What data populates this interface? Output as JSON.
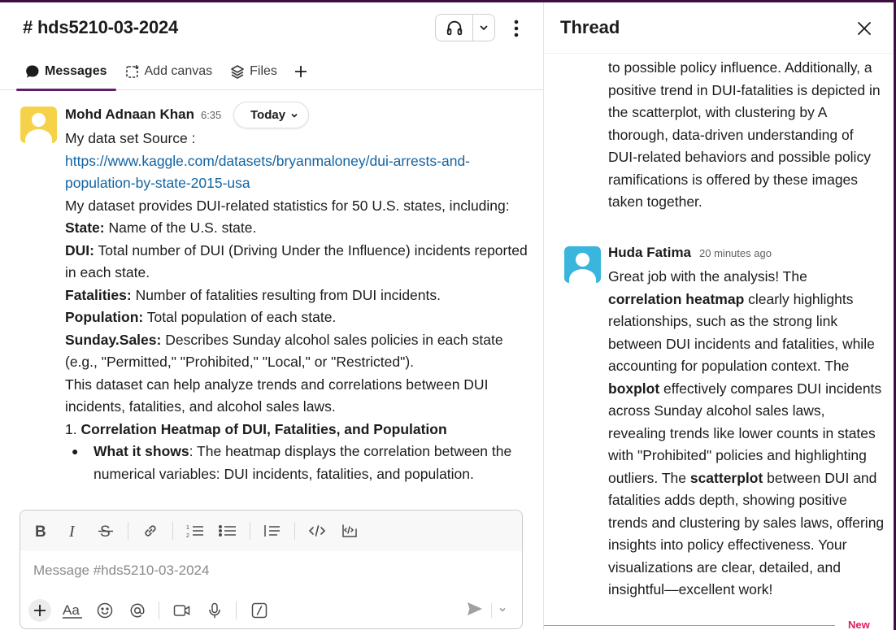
{
  "channel": {
    "name": "# hds5210-03-2024",
    "tabs": [
      {
        "label": "Messages"
      },
      {
        "label": "Add canvas"
      },
      {
        "label": "Files"
      }
    ]
  },
  "message": {
    "author": "Mohd Adnaan Khan",
    "time": "6:35",
    "date_pill": "Today",
    "line1": "My data set Source :",
    "link": "https://www.kaggle.com/datasets/bryanmaloney/dui-arrests-and-population-by-state-2015-usa",
    "intro": "My dataset provides DUI-related statistics for 50 U.S. states, including:",
    "fields": [
      {
        "name": "State:",
        "desc": " Name of the U.S. state."
      },
      {
        "name": "DUI:",
        "desc": " Total number of DUI (Driving Under the Influence) incidents reported in each state."
      },
      {
        "name": "Fatalities:",
        "desc": " Number of fatalities resulting from DUI incidents."
      },
      {
        "name": "Population:",
        "desc": " Total population of each state."
      },
      {
        "name": "Sunday.Sales:",
        "desc": " Describes Sunday alcohol sales policies in each state (e.g., \"Permitted,\" \"Prohibited,\" \"Local,\" or \"Restricted\")."
      }
    ],
    "summary": "This dataset can help analyze trends and correlations between DUI incidents, fatalities, and alcohol sales laws.",
    "list_num": "1.",
    "list_title": "Correlation Heatmap of DUI, Fatalities, and Population",
    "bullet_label": "What it shows",
    "bullet_text": ": The heatmap displays the correlation between the numerical variables: DUI incidents, fatalities, and population."
  },
  "composer": {
    "placeholder": "Message #hds5210-03-2024"
  },
  "thread": {
    "title": "Thread",
    "parent_tail": "to possible policy influence. Additionally, a positive trend in DUI-fatalities is depicted in the scatterplot, with clustering by A thorough, data-driven understanding of DUI-related behaviors and possible policy ramifications is offered by these images taken together.",
    "reply": {
      "author": "Huda Fatima",
      "time": "20 minutes ago",
      "t1": "Great job with the analysis! The ",
      "b1": "correlation heatmap",
      "t2": " clearly highlights relationships, such as the strong link between DUI incidents and fatalities, while accounting for population context. The ",
      "b2": "boxplot",
      "t3": " effectively compares DUI incidents across Sunday alcohol sales laws, revealing trends like lower counts in states with \"Prohibited\" policies and highlighting outliers. The ",
      "b3": "scatterplot",
      "t4": " between DUI and fatalities adds depth, showing positive trends and clustering by sales laws, offering insights into policy effectiveness. Your visualizations are clear, detailed, and insightful—excellent work!"
    },
    "new_label": "New"
  }
}
